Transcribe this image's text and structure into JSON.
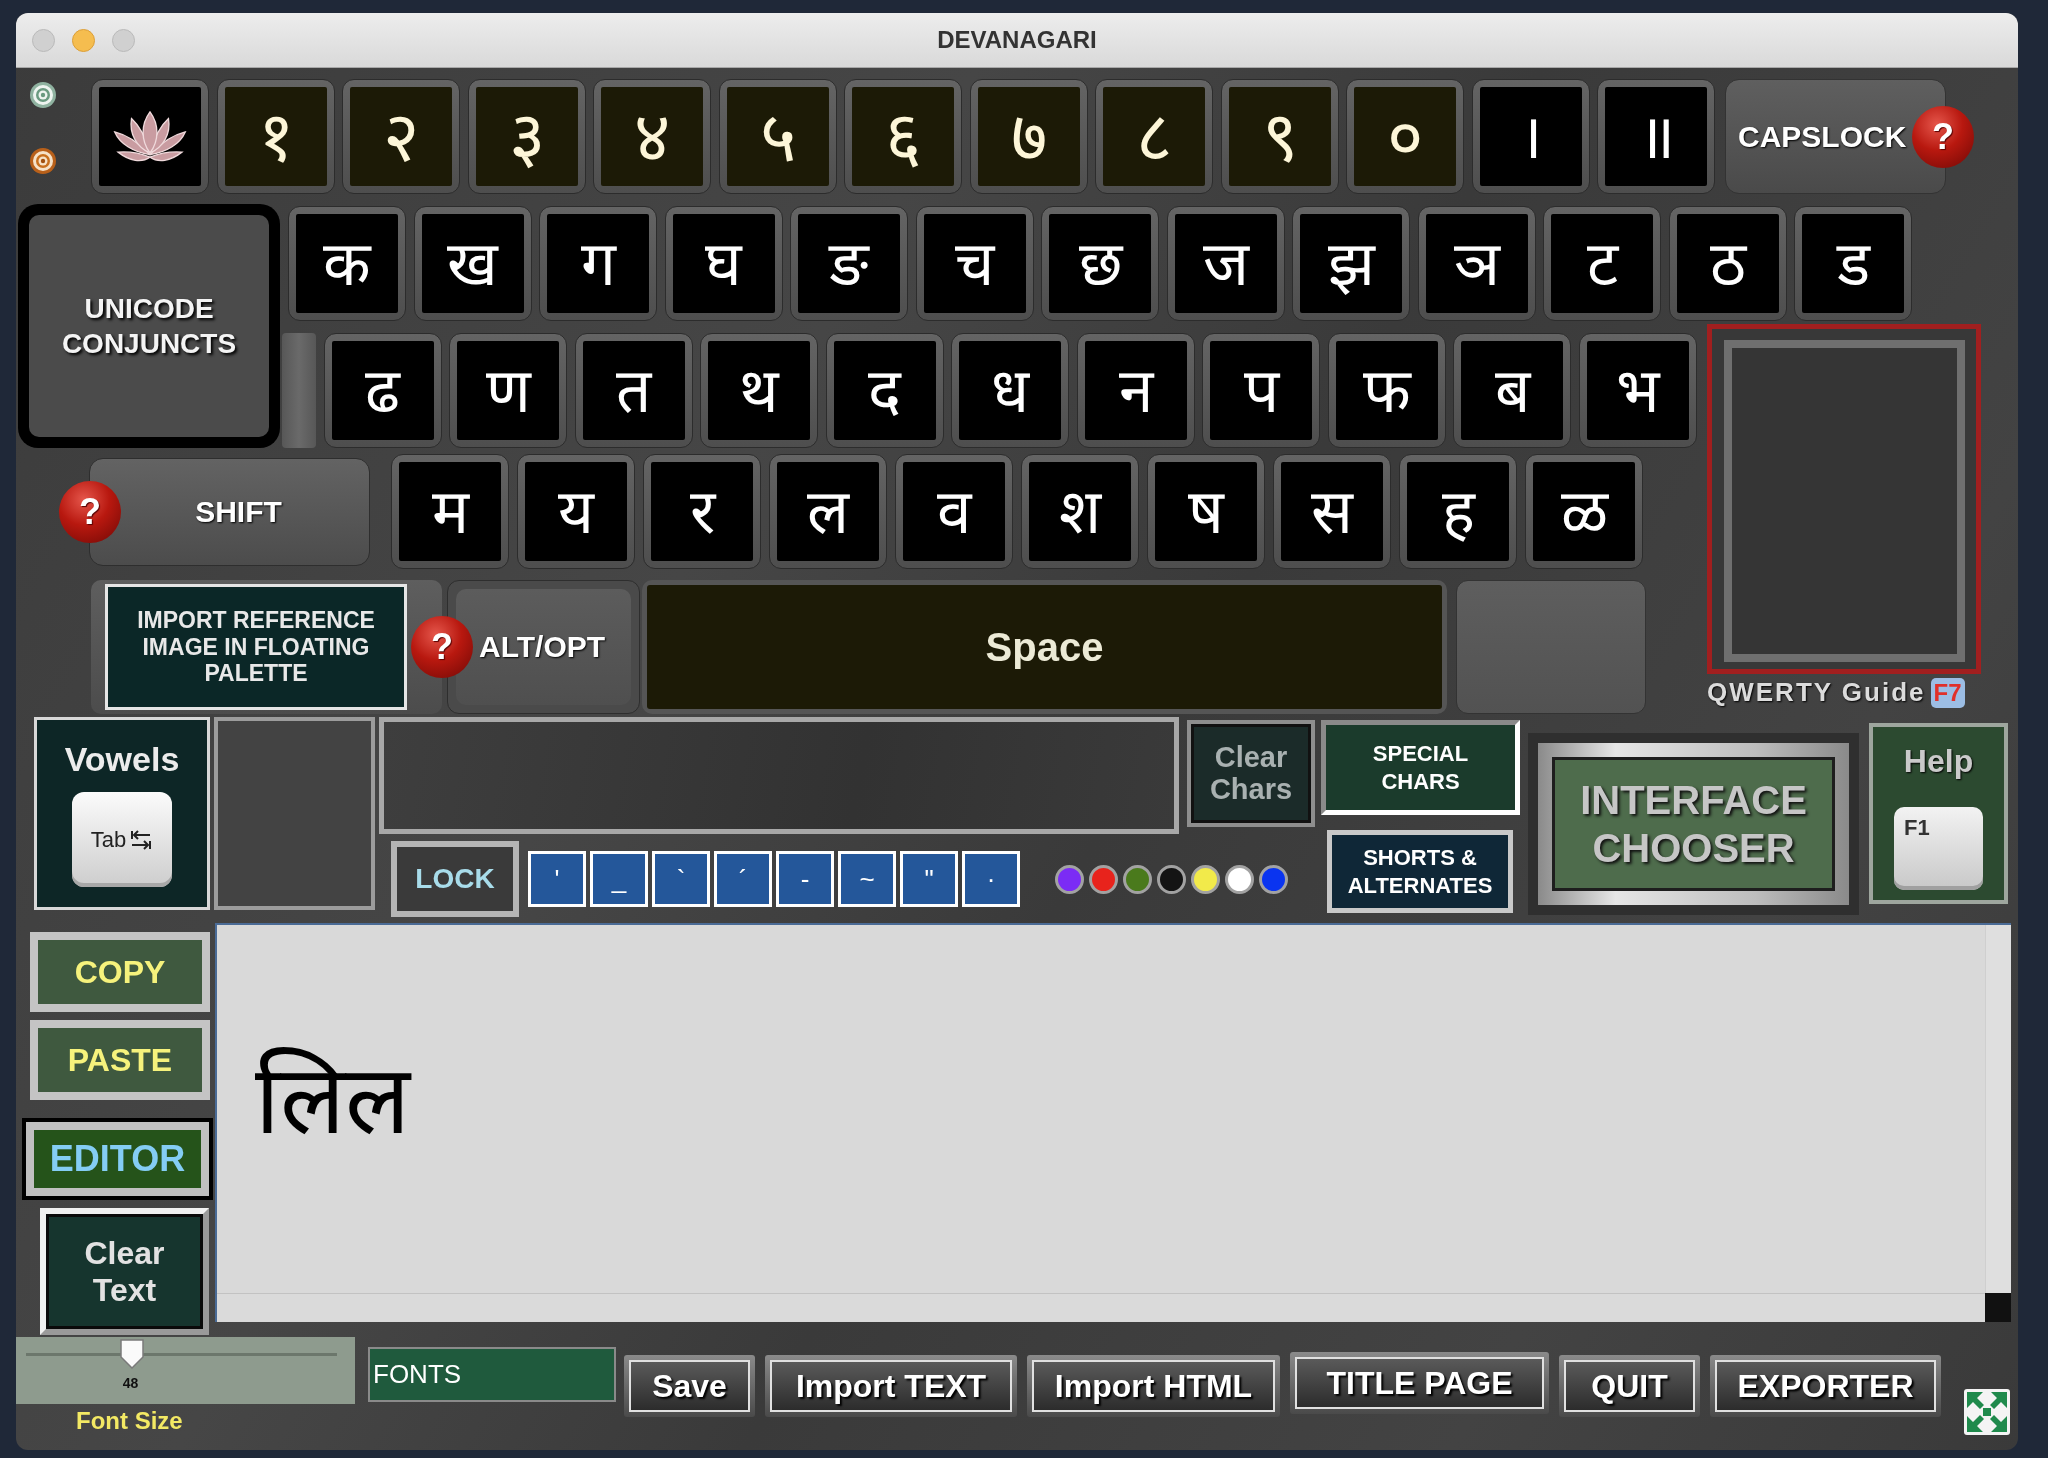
{
  "window": {
    "title": "DEVANAGARI"
  },
  "number_row": {
    "keys": [
      {
        "char": "१",
        "kind": "digit"
      },
      {
        "char": "२",
        "kind": "digit"
      },
      {
        "char": "३",
        "kind": "digit"
      },
      {
        "char": "४",
        "kind": "digit"
      },
      {
        "char": "५",
        "kind": "digit"
      },
      {
        "char": "६",
        "kind": "digit"
      },
      {
        "char": "७",
        "kind": "digit"
      },
      {
        "char": "८",
        "kind": "digit"
      },
      {
        "char": "९",
        "kind": "digit"
      },
      {
        "char": "०",
        "kind": "digit"
      },
      {
        "char": "।",
        "kind": "danda"
      },
      {
        "char": "॥",
        "kind": "danda"
      }
    ]
  },
  "capslock": {
    "label": "CAPSLOCK",
    "help": "?"
  },
  "conjuncts_button": {
    "lines": [
      "UNICODE",
      "CONJUNCTS"
    ]
  },
  "consonant_rows": [
    [
      "क",
      "ख",
      "ग",
      "घ",
      "ङ",
      "च",
      "छ",
      "ज",
      "झ",
      "ञ",
      "ट",
      "ठ",
      "ड"
    ],
    [
      "ढ",
      "ण",
      "त",
      "थ",
      "द",
      "ध",
      "न",
      "प",
      "फ",
      "ब",
      "भ"
    ],
    [
      "म",
      "य",
      "र",
      "ल",
      "व",
      "श",
      "ष",
      "स",
      "ह",
      "ळ"
    ]
  ],
  "shift": {
    "label": "SHIFT",
    "help": "?"
  },
  "import_reference": {
    "lines": [
      "IMPORT REFERENCE",
      "IMAGE IN FLOATING",
      "PALETTE"
    ]
  },
  "alt_opt": {
    "label": "ALT/OPT",
    "help": "?"
  },
  "space": {
    "label": "Space"
  },
  "qwerty_guide": {
    "label": "QWERTY Guide",
    "shortcut": "F7"
  },
  "vowels": {
    "label": "Vowels",
    "key": "Tab"
  },
  "lock": {
    "label": "LOCK"
  },
  "accent_keys": [
    "'",
    "_",
    "`",
    "´",
    "-",
    "~",
    "\"",
    "·"
  ],
  "color_swatches": [
    {
      "color": "#7b2cf5"
    },
    {
      "color": "#e8231c"
    },
    {
      "color": "#4a7a1c"
    },
    {
      "color": "#141414"
    },
    {
      "color": "#f2ea4a"
    },
    {
      "color": "#ffffff"
    },
    {
      "color": "#0a34f0"
    }
  ],
  "clear_chars": {
    "lines": [
      "Clear",
      "Chars"
    ]
  },
  "special_chars": {
    "lines": [
      "SPECIAL",
      "CHARS"
    ]
  },
  "shorts_alternates": {
    "lines": [
      "SHORTS &",
      "ALTERNATES"
    ]
  },
  "interface_chooser": {
    "lines": [
      "INTERFACE",
      "CHOOSER"
    ]
  },
  "help": {
    "label": "Help",
    "key": "F1"
  },
  "side_buttons": [
    {
      "kind": "clipboard",
      "lines": [
        "COPY"
      ]
    },
    {
      "kind": "clipboard",
      "lines": [
        "PASTE"
      ]
    },
    {
      "kind": "mode",
      "lines": [
        "EDITOR"
      ]
    },
    {
      "kind": "reset",
      "lines": [
        "Clear",
        "Text"
      ]
    }
  ],
  "editor": {
    "text": "लिल"
  },
  "font_size": {
    "level": 0.34,
    "value": "48",
    "label": "Font Size"
  },
  "fonts_field": {
    "value": "FONTS"
  },
  "bottom_buttons": [
    "Save",
    "Import TEXT",
    "Import HTML",
    "TITLE PAGE",
    "QUIT",
    "EXPORTER"
  ]
}
